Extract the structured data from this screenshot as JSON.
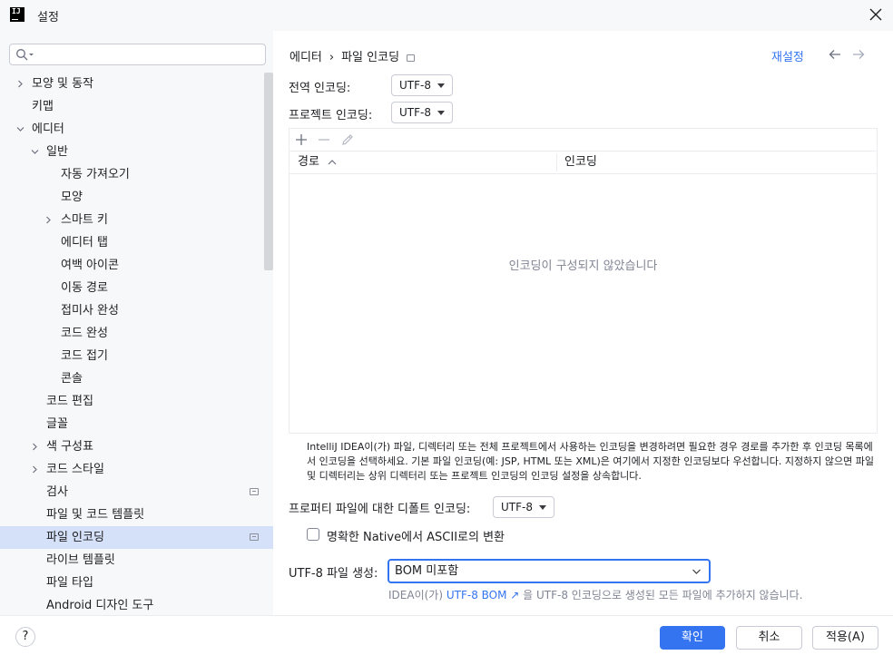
{
  "window": {
    "title": "설정"
  },
  "search": {
    "placeholder": ""
  },
  "sidebar": {
    "items": [
      {
        "label": "모양 및 동작",
        "indent": 0,
        "expandable": true,
        "expanded": false
      },
      {
        "label": "키맵",
        "indent": 0,
        "expandable": false
      },
      {
        "label": "에디터",
        "indent": 0,
        "expandable": true,
        "expanded": true
      },
      {
        "label": "일반",
        "indent": 1,
        "expandable": true,
        "expanded": true
      },
      {
        "label": "자동 가져오기",
        "indent": 2,
        "expandable": false
      },
      {
        "label": "모양",
        "indent": 2,
        "expandable": false
      },
      {
        "label": "스마트 키",
        "indent": 2,
        "expandable": true,
        "expanded": false
      },
      {
        "label": "에디터 탭",
        "indent": 2,
        "expandable": false
      },
      {
        "label": "여백 아이콘",
        "indent": 2,
        "expandable": false
      },
      {
        "label": "이동 경로",
        "indent": 2,
        "expandable": false
      },
      {
        "label": "접미사 완성",
        "indent": 2,
        "expandable": false
      },
      {
        "label": "코드 완성",
        "indent": 2,
        "expandable": false
      },
      {
        "label": "코드 접기",
        "indent": 2,
        "expandable": false
      },
      {
        "label": "콘솔",
        "indent": 2,
        "expandable": false
      },
      {
        "label": "코드 편집",
        "indent": 1,
        "expandable": false
      },
      {
        "label": "글꼴",
        "indent": 1,
        "expandable": false
      },
      {
        "label": "색 구성표",
        "indent": 1,
        "expandable": true,
        "expanded": false
      },
      {
        "label": "코드 스타일",
        "indent": 1,
        "expandable": true,
        "expanded": false
      },
      {
        "label": "검사",
        "indent": 1,
        "expandable": false,
        "project_icon": true
      },
      {
        "label": "파일 및 코드 템플릿",
        "indent": 1,
        "expandable": false
      },
      {
        "label": "파일 인코딩",
        "indent": 1,
        "expandable": false,
        "selected": true,
        "project_icon": true
      },
      {
        "label": "라이브 템플릿",
        "indent": 1,
        "expandable": false
      },
      {
        "label": "파일 타입",
        "indent": 1,
        "expandable": false
      },
      {
        "label": "Android 디자인 도구",
        "indent": 1,
        "expandable": false
      }
    ]
  },
  "breadcrumb": {
    "parent": "에디터",
    "separator": "›",
    "current": "파일 인코딩"
  },
  "header": {
    "reset_label": "재설정"
  },
  "global_encoding": {
    "label": "전역 인코딩:",
    "value": "UTF-8"
  },
  "project_encoding": {
    "label": "프로젝트 인코딩:",
    "value": "UTF-8"
  },
  "table": {
    "columns": [
      "경로",
      "인코딩"
    ],
    "sort_column": "경로",
    "empty_text": "인코딩이 구성되지 않았습니다",
    "rows": []
  },
  "help_text": "IntelliJ IDEA이(가) 파일, 디렉터리 또는 전체 프로젝트에서 사용하는 인코딩을 변경하려면 필요한 경우 경로를 추가한 후 인코딩 목록에서 인코딩을 선택하세요. 기본 파일 인코딩(예: JSP, HTML 또는 XML)은 여기에서 지정한 인코딩보다 우선합니다. 지정하지 않으면 파일 및 디렉터리는 상위 디렉터리 또는 프로젝트 인코딩의 인코딩 설정을 상속합니다.",
  "properties_encoding": {
    "label": "프로퍼티 파일에 대한 디폴트 인코딩:",
    "value": "UTF-8"
  },
  "native_to_ascii": {
    "label": "명확한 Native에서 ASCII로의 변환",
    "checked": false
  },
  "bom": {
    "label": "UTF-8 파일 생성:",
    "value": "BOM 미포함",
    "hint_prefix": "IDEA이(가) ",
    "hint_link": "UTF-8 BOM ↗",
    "hint_suffix": " 을 UTF-8 인코딩으로 생성된 모든 파일에 추가하지 않습니다."
  },
  "footer": {
    "help_label": "?",
    "ok_label": "확인",
    "cancel_label": "취소",
    "apply_label": "적용(A)"
  },
  "colors": {
    "accent": "#3574f0",
    "selection": "#d5e1f8",
    "sidebar_bg": "#f7f8fa",
    "muted_text": "#818594"
  }
}
